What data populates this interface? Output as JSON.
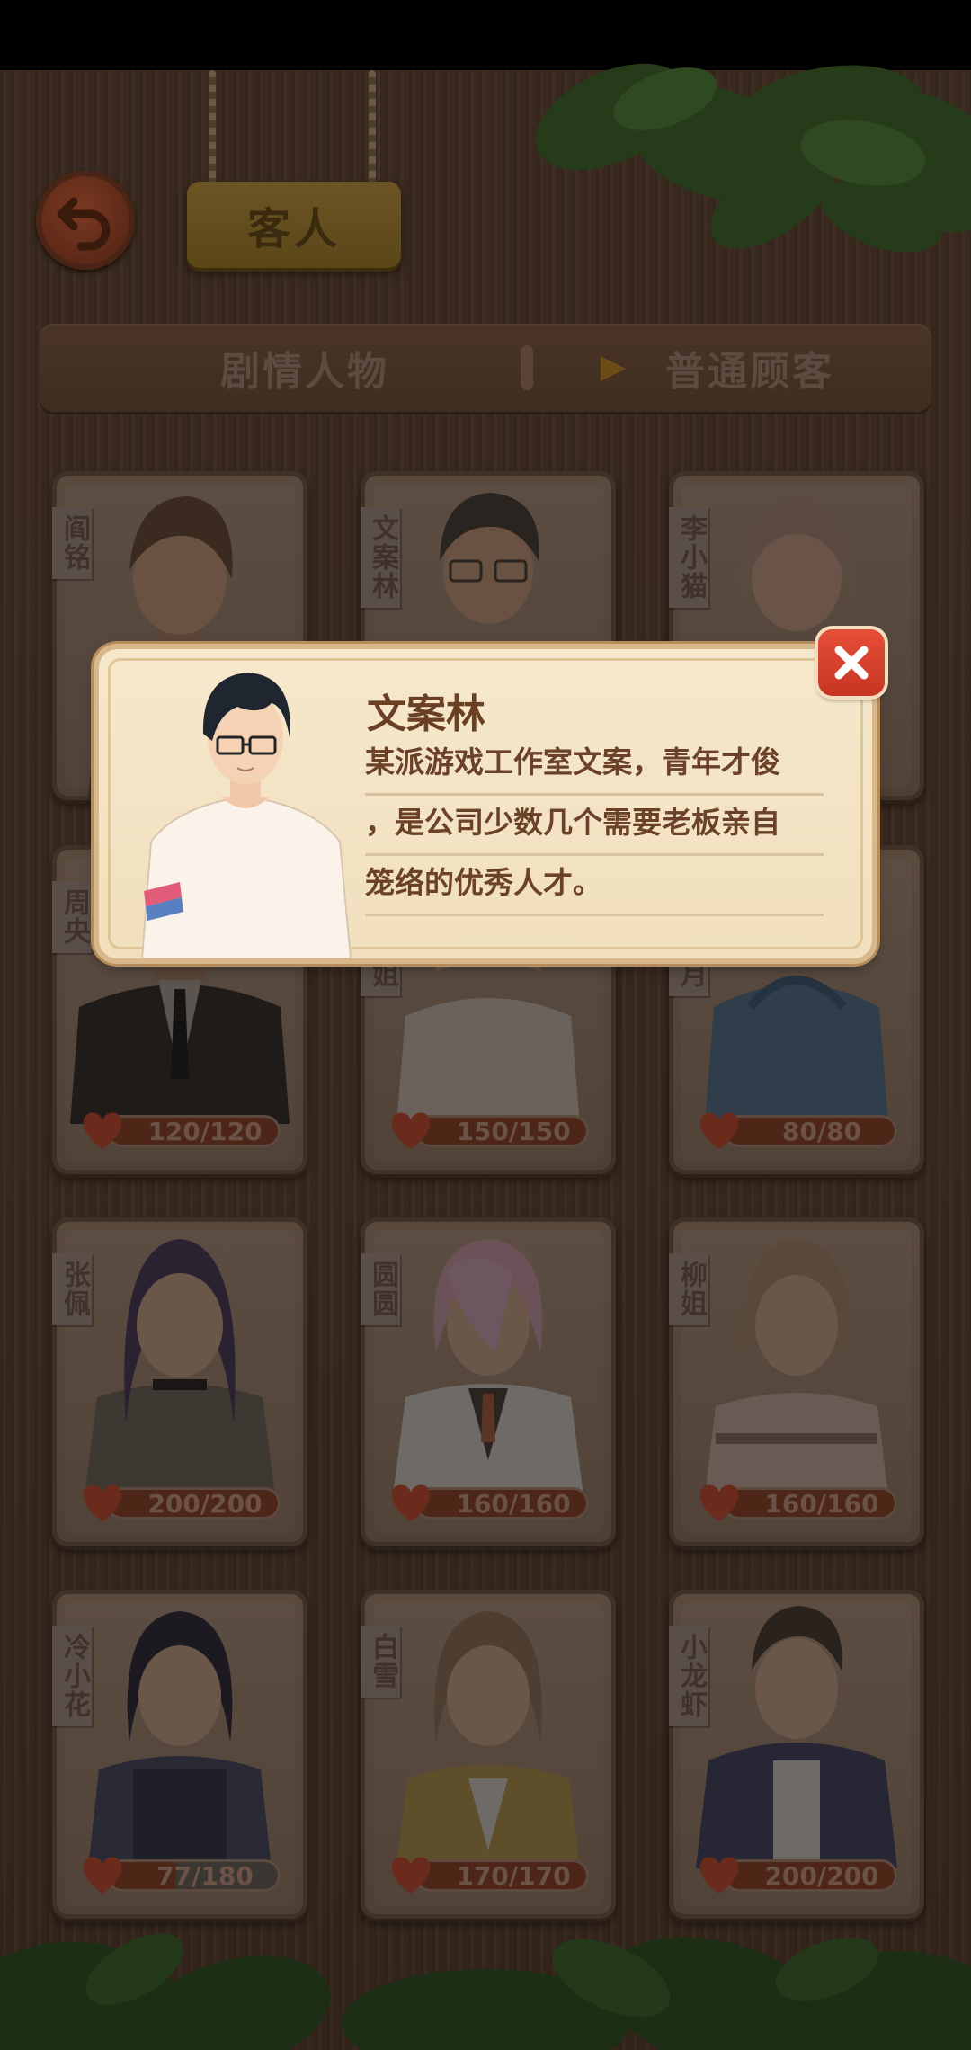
{
  "header": {
    "title": "客人"
  },
  "tabs": {
    "story_label": "剧情人物",
    "normal_label": "普通顾客"
  },
  "cards": [
    {
      "name": "阎铭",
      "hp": ""
    },
    {
      "name": "文案林",
      "hp": ""
    },
    {
      "name": "李小猫",
      "hp": ""
    },
    {
      "name": "周央",
      "hp": "120/120"
    },
    {
      "name": "姐",
      "hp": "150/150"
    },
    {
      "name": "月",
      "hp": "80/80"
    },
    {
      "name": "张佩",
      "hp": "200/200"
    },
    {
      "name": "圆圆",
      "hp": "160/160"
    },
    {
      "name": "柳姐",
      "hp": "160/160"
    },
    {
      "name": "冷小花",
      "hp": "77/180"
    },
    {
      "name": "白雪",
      "hp": "170/170"
    },
    {
      "name": "小龙虾",
      "hp": "200/200"
    }
  ],
  "popup": {
    "name": "文案林",
    "lines": [
      "某派游戏工作室文案，青年才俊",
      "，是公司少数几个需要老板亲自",
      "笼络的优秀人才。"
    ]
  },
  "icons": {
    "back": "back-arrow-icon",
    "close": "close-icon",
    "heart": "heart-icon",
    "tab_arrow": "play-arrow-icon"
  },
  "colors": {
    "background": "#3a2a1f",
    "popup_bg": "#f4e4c6",
    "popup_text": "#6b4229",
    "close_red": "#d9412c",
    "title_plank": "#6c5524"
  }
}
